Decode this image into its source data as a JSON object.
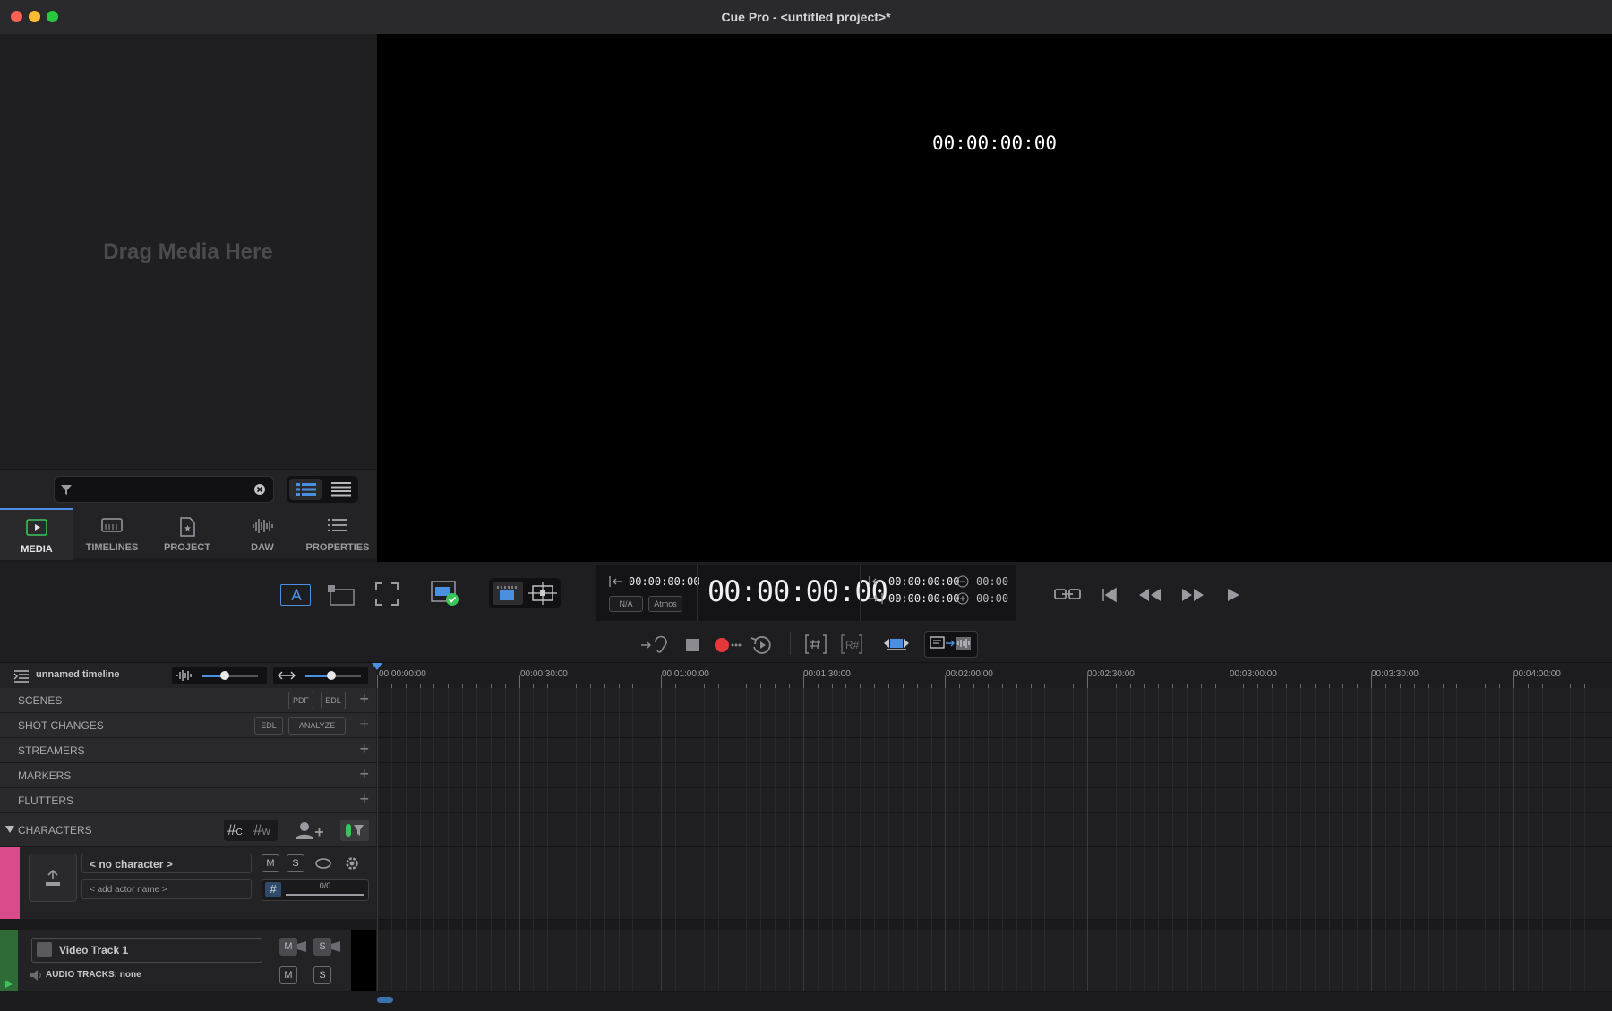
{
  "window": {
    "title": "Cue Pro - <untitled project>*"
  },
  "media": {
    "drop_hint": "Drag Media Here"
  },
  "tabs": [
    {
      "label": "MEDIA"
    },
    {
      "label": "TIMELINES"
    },
    {
      "label": "PROJECT"
    },
    {
      "label": "DAW"
    },
    {
      "label": "PROPERTIES"
    }
  ],
  "viewer": {
    "timecode": "00:00:00:00"
  },
  "transport": {
    "in_tc": "00:00:00:00",
    "na_label": "N/A",
    "atmos_label": "Atmos",
    "main_tc": "00:00:00:00",
    "range_in": "00:00:00:00",
    "range_out": "00:00:00:00",
    "minus_val": "00:00",
    "plus_val": "00:00"
  },
  "timeline": {
    "name": "unnamed timeline",
    "ruler": [
      "00:00:00:00",
      "00:00:30:00",
      "00:01:00:00",
      "00:01:30:00",
      "00:02:00:00",
      "00:02:30:00",
      "00:03:00:00",
      "00:03:30:00",
      "00:04:00:00"
    ]
  },
  "sections": {
    "scenes": "SCENES",
    "scenes_pdf": "PDF",
    "scenes_edl": "EDL",
    "shot_changes": "SHOT CHANGES",
    "shot_edl": "EDL",
    "shot_analyze": "ANALYZE",
    "streamers": "STREAMERS",
    "markers": "MARKERS",
    "flutters": "FLUTTERS",
    "characters": "CHARACTERS"
  },
  "character": {
    "name": "< no character >",
    "actor": "< add actor name >",
    "progress": "0/0",
    "mute": "M",
    "solo": "S",
    "color": "#d94b8a"
  },
  "video_track": {
    "name": "Video Track 1",
    "audio": "AUDIO TRACKS: none",
    "mute": "M",
    "solo": "S",
    "color": "#2f6b36"
  }
}
